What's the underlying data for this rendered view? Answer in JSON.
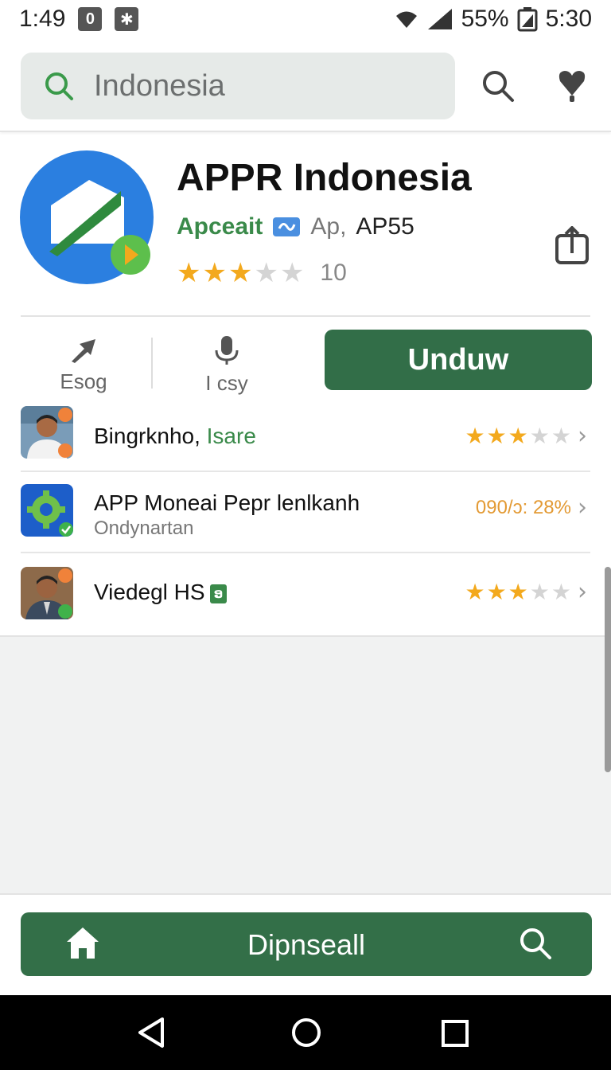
{
  "status_bar": {
    "time_left": "1:49",
    "badge": "0",
    "battery_percent": "55%",
    "time_right": "5:30"
  },
  "search": {
    "query": "Indonesia"
  },
  "app": {
    "title": "APPR Indonesia",
    "developer": "Apceait",
    "meta_ap": "Ap,",
    "meta_code": "AP55",
    "rating": 3,
    "rating_count": "10"
  },
  "actions": {
    "share_label": "Esog",
    "mic_label": "I csy",
    "install_label": "Unduw"
  },
  "list": {
    "items": [
      {
        "title_main": "Bingrknho,",
        "title_accent": " Isare",
        "rating": 3
      },
      {
        "title_main": "APP Moneai Pepr lenlkanh",
        "subtitle": "Ondynartan",
        "percent": "090/ɔ: 28%"
      },
      {
        "title_main": "Viedegl HS",
        "tag": "ອ",
        "rating": 3
      }
    ]
  },
  "bottom_bar": {
    "label": "Dipnseall"
  },
  "colors": {
    "accent_green": "#336f48",
    "text_green": "#3a8a4a",
    "star_gold": "#f3a91d",
    "percent_orange": "#e39a34",
    "search_bg": "#e6eae8"
  },
  "icons": [
    "search-icon",
    "heart-icon",
    "share-icon",
    "arrow-icon",
    "mic-icon",
    "home-icon",
    "back-icon",
    "circle-home-icon",
    "recent-apps-icon",
    "chevron-right-icon"
  ]
}
